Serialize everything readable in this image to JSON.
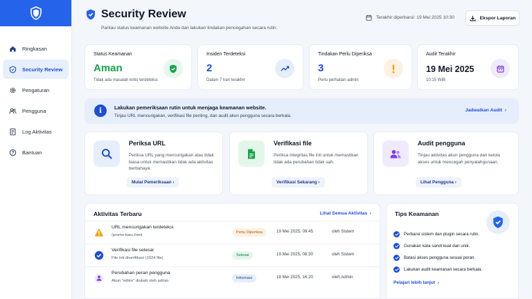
{
  "sidebar": {
    "items": [
      {
        "label": "Ringkasan",
        "icon": "home-icon"
      },
      {
        "label": "Security Review",
        "icon": "shield-icon",
        "active": true
      },
      {
        "label": "Pengaturan",
        "icon": "gear-icon"
      },
      {
        "label": "Pengguna",
        "icon": "users-icon"
      },
      {
        "label": "Log Aktivitas",
        "icon": "document-icon"
      },
      {
        "label": "Bantuan",
        "icon": "help-icon"
      }
    ]
  },
  "header": {
    "title": "Security Review",
    "subtitle": "Pantau status keamanan website Anda dan lakukan tindakan pencegahan secara rutin.",
    "last_updated": "Terakhir diperbarui: 19 Mei 2025 10:30",
    "export_label": "Ekspor Laporan"
  },
  "stats": [
    {
      "label": "Status Keamanan",
      "value": "Aman",
      "note": "Tidak ada masalah kritis terdeteksi.",
      "icon": "shield-check-icon",
      "color": "#16a34a",
      "bg": "#e7f7ed"
    },
    {
      "label": "Insiden Terdeteksi",
      "value": "2",
      "note": "Dalam 7 hari terakhir",
      "icon": "trend-icon",
      "color": "#1d4ed8",
      "bg": "#e6eefb"
    },
    {
      "label": "Tindakan Perlu Diperiksa",
      "value": "3",
      "note": "Perlu perhatian admin",
      "icon": "alert-icon",
      "color": "#1d4ed8",
      "bg": "#fdf1e2"
    },
    {
      "label": "Audit Terakhir",
      "value": "19 Mei 2025",
      "note": "10:15 WIB",
      "icon": "calendar-icon",
      "color": "#111827",
      "bg": "#f0ebfb"
    }
  ],
  "banner": {
    "title": "Lakukan pemeriksaan rutin untuk menjaga keamanan website.",
    "text": "Tinjau URL mencurigakan, verifikasi file penting, dan audit akun pengguna secara berkala.",
    "link": "Jadwalkan Audit"
  },
  "features": [
    {
      "title": "Periksa URL",
      "text": "Periksa URL yang mencurigakan atau tidak biasa untuk memastikan tidak ada aktivitas berbahaya.",
      "button": "Mulai Pemeriksaan",
      "icon": "search-icon"
    },
    {
      "title": "Verifikasi file",
      "text": "Periksa integritas file inti untuk memastikan tidak ada perubahan tidak sah.",
      "button": "Verifikasi Sekarang",
      "icon": "file-icon"
    },
    {
      "title": "Audit pengguna",
      "text": "Tinjau aktivitas akun pengguna dan kelola akses untuk mencegah penyalahgunaan.",
      "button": "Lihat Pengguna",
      "icon": "users-icon"
    }
  ],
  "activity": {
    "title": "Aktivitas Terbaru",
    "see_all": "Lihat Semua Aktivitas",
    "rows": [
      {
        "title": "URL mencurigakan terdeteksi",
        "sub": "/promo-baru.html",
        "badge": "Perlu Diperiksa",
        "badge_color": "#b45309",
        "badge_bg": "#fdf1e2",
        "date": "19 Mei 2025, 09:45",
        "by": "oleh Sistem",
        "icon": "warning-icon"
      },
      {
        "title": "Verifikasi file selesai",
        "sub": "File inti diverifikasi (1024 file)",
        "badge": "Selesai",
        "badge_color": "#15803d",
        "badge_bg": "#e3f6ea",
        "date": "19 Mei 2025, 08:30",
        "by": "oleh Sistem",
        "icon": "check-circle-icon"
      },
      {
        "title": "Perubahan peran pengguna",
        "sub": "Akun \"editor\" diubah oleh admin",
        "badge": "Informasi",
        "badge_color": "#1e3a8a",
        "badge_bg": "#e6eefb",
        "date": "18 Mei 2025, 16:20",
        "by": "oleh Admin",
        "icon": "user-icon"
      }
    ]
  },
  "tips": {
    "title": "Tips Keamanan",
    "items": [
      "Perbarui sistem dan plugin secara rutin.",
      "Gunakan kata sandi kuat dan unik.",
      "Batasi akses pengguna sesuai peran.",
      "Lakukan audit keamanan secara berkala."
    ],
    "link": "Pelajari lebih lanjut"
  },
  "colors": {
    "accent": "#2563eb",
    "success": "#16a34a",
    "warning": "#f59e0b"
  }
}
